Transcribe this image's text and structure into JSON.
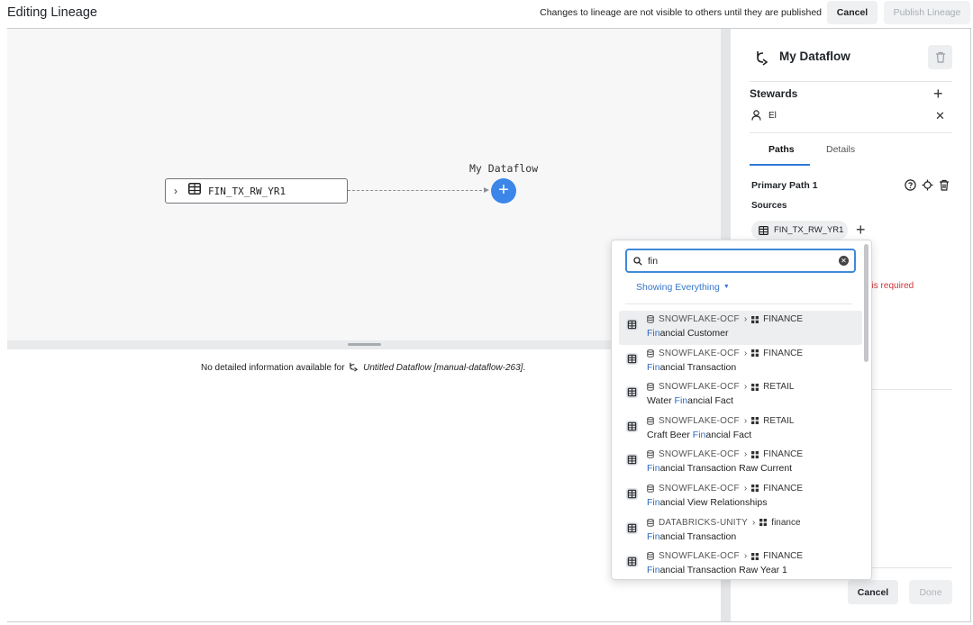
{
  "header": {
    "title": "Editing Lineage",
    "notice": "Changes to lineage are not visible to others until they are published",
    "cancel_label": "Cancel",
    "publish_label": "Publish Lineage"
  },
  "graph": {
    "source_node_label": "FIN_TX_RW_YR1",
    "dataflow_label": "My Dataflow",
    "add_symbol": "+"
  },
  "details": {
    "prefix": "No detailed information available for",
    "dataflow_name": "Untitled Dataflow [manual-dataflow-263]",
    "suffix": "."
  },
  "panel": {
    "title": "My Dataflow",
    "stewards_label": "Stewards",
    "steward_name": "El",
    "tabs": [
      {
        "label": "Paths",
        "active": true
      },
      {
        "label": "Details",
        "active": false
      }
    ],
    "primary_path_label": "Primary Path 1",
    "sources_label": "Sources",
    "source_chip": "FIN_TX_RW_YR1",
    "required_text": "t is required",
    "cancel_label": "Cancel",
    "done_label": "Done"
  },
  "dropdown": {
    "search_value": "fin",
    "filter_label": "Showing Everything",
    "results": [
      {
        "source": "SNOWFLAKE-OCF",
        "schema": "FINANCE",
        "match": "Fin",
        "rest_before": "",
        "rest_after": "ancial Customer",
        "selected": true
      },
      {
        "source": "SNOWFLAKE-OCF",
        "schema": "FINANCE",
        "match": "Fin",
        "rest_before": "",
        "rest_after": "ancial Transaction",
        "selected": false
      },
      {
        "source": "SNOWFLAKE-OCF",
        "schema": "RETAIL",
        "match": "Fin",
        "rest_before": "Water ",
        "rest_after": "ancial Fact",
        "selected": false
      },
      {
        "source": "SNOWFLAKE-OCF",
        "schema": "RETAIL",
        "match": "Fin",
        "rest_before": "Craft Beer ",
        "rest_after": "ancial Fact",
        "selected": false
      },
      {
        "source": "SNOWFLAKE-OCF",
        "schema": "FINANCE",
        "match": "Fin",
        "rest_before": "",
        "rest_after": "ancial Transaction Raw Current",
        "selected": false
      },
      {
        "source": "SNOWFLAKE-OCF",
        "schema": "FINANCE",
        "match": "Fin",
        "rest_before": "",
        "rest_after": "ancial View Relationships",
        "selected": false
      },
      {
        "source": "DATABRICKS-UNITY",
        "schema": "finance",
        "match": "Fin",
        "rest_before": "",
        "rest_after": "ancial Transaction",
        "selected": false
      },
      {
        "source": "SNOWFLAKE-OCF",
        "schema": "FINANCE",
        "match": "Fin",
        "rest_before": "",
        "rest_after": "ancial Transaction Raw Year 1",
        "selected": false
      }
    ]
  },
  "colors": {
    "accent": "#3b86e8",
    "highlight": "#2d6bc2",
    "error": "#d1343a"
  }
}
